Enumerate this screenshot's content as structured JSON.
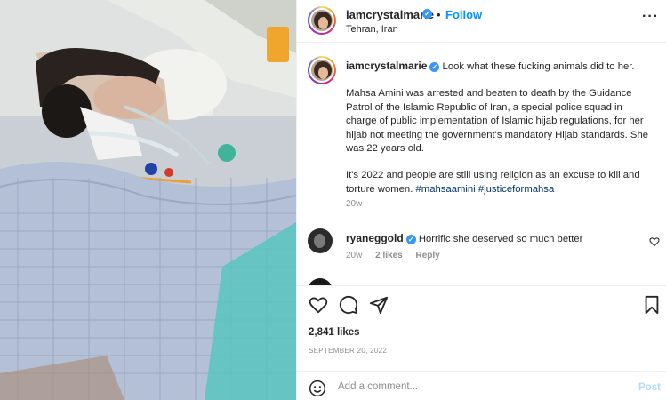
{
  "post": {
    "username": "iamcrystalmarie",
    "follow_label": "Follow",
    "dot": "•",
    "location": "Tehran, Iran",
    "more_label": "···"
  },
  "caption": {
    "username": "iamcrystalmarie",
    "line1": "Look what these fucking animals did to her.",
    "para2": "Mahsa Amini was arrested and beaten to death by the Guidance Patrol of the Islamic Republic of Iran, a special police squad in charge of public implementation of Islamic hijab regulations, for her hijab not meeting the government's mandatory Hijab standards. She was 22 years old.",
    "para3": "It's 2022 and people are still using religion as an excuse to kill and torture women.",
    "hashtag1": "#mahsaamini",
    "hashtag2": "#justiceformahsa",
    "time": "20w"
  },
  "comments": [
    {
      "username": "ryaneggold",
      "text": "Horrific she deserved so much better",
      "time": "20w",
      "likes": "2 likes",
      "reply_label": "Reply"
    }
  ],
  "likes": "2,841 likes",
  "date": "SEPTEMBER 20, 2022",
  "add_comment": {
    "placeholder": "Add a comment...",
    "post_label": "Post"
  },
  "icons": {
    "like": "heart-icon",
    "comment": "comment-icon",
    "share": "share-icon",
    "save": "bookmark-icon",
    "emoji": "emoji-icon",
    "verified": "verified-badge-icon"
  },
  "colors": {
    "accent": "#0095f6",
    "hashtag": "#00376b",
    "muted": "#8e8e8e",
    "post_disabled": "#b3dbff",
    "verified": "#3897f0"
  }
}
